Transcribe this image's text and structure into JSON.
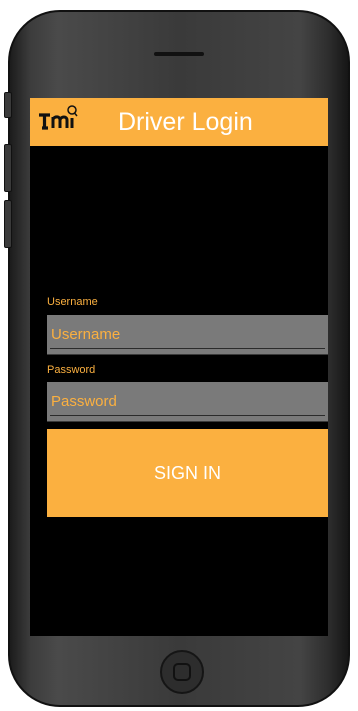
{
  "app": {
    "title": "Driver Login",
    "logo_icon": "fmi-logo-icon"
  },
  "form": {
    "username_label": "Username",
    "username_placeholder": "Username",
    "username_value": "",
    "password_label": "Password",
    "password_placeholder": "Password",
    "password_value": "",
    "signin_label": "SIGN IN"
  },
  "colors": {
    "accent": "#fbb040",
    "screen_background": "#000000",
    "field_background": "#7a7a7a",
    "text_on_accent": "#ffffff"
  }
}
